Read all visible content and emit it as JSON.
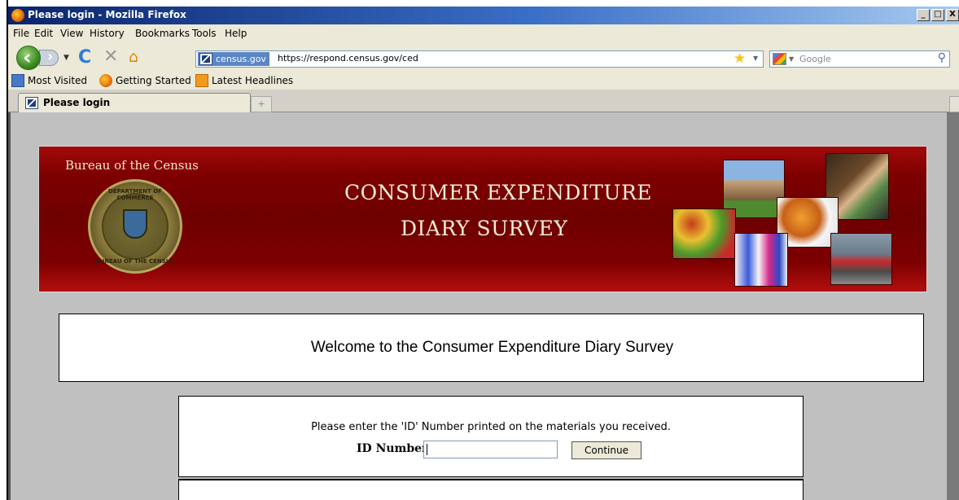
{
  "window": {
    "title": "Please login - Mozilla Firefox",
    "controls": [
      "_",
      "□",
      "X"
    ]
  },
  "menu": [
    "File",
    "Edit",
    "View",
    "History",
    "Bookmarks",
    "Tools",
    "Help"
  ],
  "navigation": {
    "site_identity": "census.gov",
    "url": "https://respond.census.gov/ced",
    "search_placeholder": "Google"
  },
  "bookmarks": [
    "Most Visited",
    "Getting Started",
    "Latest Headlines"
  ],
  "tabs": [
    {
      "label": "Please login",
      "active": true
    }
  ],
  "banner": {
    "bureau": "Bureau of the Census",
    "title_line1": "CONSUMER EXPENDITURE",
    "title_line2": "DIARY SURVEY",
    "seal_top": "DEPARTMENT OF COMMERCE",
    "seal_bottom": "BUREAU OF THE CENSUS"
  },
  "welcome": "Welcome to the Consumer Expenditure Diary Survey",
  "login": {
    "instruction": "Please enter the 'ID' Number printed on the materials you received.",
    "id_label": "ID Number:",
    "id_value": "",
    "continue_label": "Continue"
  },
  "colors": {
    "banner_red": "#7d0000",
    "title_bar": "#0a246a"
  }
}
